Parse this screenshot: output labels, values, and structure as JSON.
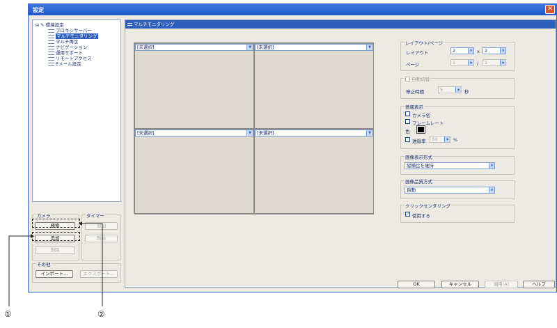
{
  "window": {
    "title": "設定",
    "close_glyph": "✕"
  },
  "tree": {
    "root": "環境設定",
    "items": [
      {
        "label": "プロキシサーバー",
        "selected": false
      },
      {
        "label": "マルチモニタリング",
        "selected": true
      },
      {
        "label": "マルチ再生",
        "selected": false
      },
      {
        "label": "ナビゲーション",
        "selected": false
      },
      {
        "label": "運用サポート",
        "selected": false
      },
      {
        "label": "リモートアクセス",
        "selected": false
      },
      {
        "label": "Eメール設定",
        "selected": false
      }
    ]
  },
  "left_groups": {
    "camera": {
      "title": "カメラ",
      "search": "検索",
      "add": "追加",
      "delete": "削除"
    },
    "timer": {
      "title": "タイマー",
      "add": "追加",
      "delete": "削除"
    },
    "other": {
      "title": "その他",
      "import": "インポート...",
      "export": "エクスポート..."
    }
  },
  "pane": {
    "title": "マルチモニタリング",
    "cells": [
      "[未選択]",
      "[未選択]",
      "[未選択]",
      "[未選択]"
    ],
    "layout": {
      "title": "レイアウト/ページ",
      "layout_label": "レイアウト",
      "cols": "2",
      "x": "x",
      "rows": "2",
      "page_label": "ページ",
      "page": "1",
      "slash": "/",
      "pages": "1"
    },
    "auto_switch": {
      "title": "自動切替",
      "stop_label": "停止時間",
      "stop_value": "5",
      "unit": "秒"
    },
    "info": {
      "title": "情報表示",
      "camera_name": "カメラ名",
      "frame_rate": "フレームレート",
      "color": "色",
      "transparency": "透過率",
      "transparency_value": "50",
      "percent": "%"
    },
    "image_format": {
      "title": "画像表示形式",
      "value": "縦横比を維持"
    },
    "image_quality": {
      "title": "画像品質方式",
      "value": "自動"
    },
    "click_center": {
      "title": "クリックセンタリング",
      "use": "使用する",
      "checked": "✓"
    }
  },
  "footer": {
    "ok": "OK",
    "cancel": "キャンセル",
    "apply": "適用(A)",
    "help": "ヘルプ"
  },
  "callouts": [
    "①",
    "②"
  ],
  "colors": {
    "accent": "#2e5fbd",
    "title_bar": "#2a64d6"
  }
}
